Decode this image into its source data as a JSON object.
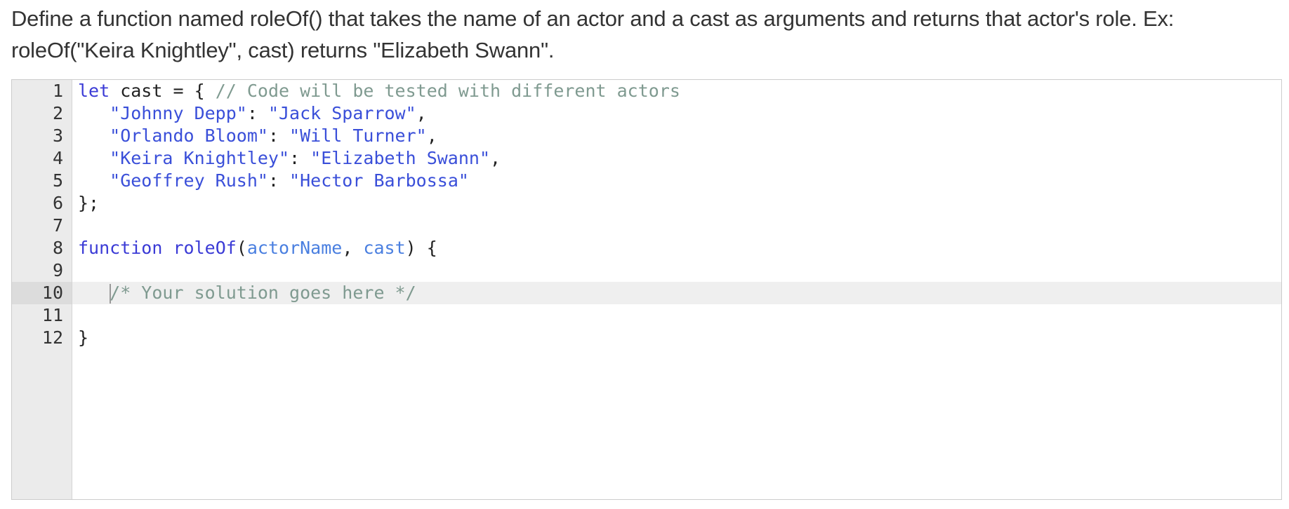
{
  "prompt": {
    "line1": "Define a function named roleOf() that takes the name of an actor and a cast as arguments and returns that actor's role. Ex:",
    "line2": "roleOf(\"Keira Knightley\", cast) returns \"Elizabeth Swann\"."
  },
  "editor": {
    "active_line": 10,
    "lines": [
      {
        "num": "1",
        "tokens": [
          {
            "t": "let",
            "c": "kw"
          },
          {
            "t": " cast ",
            "c": "pun"
          },
          {
            "t": "=",
            "c": "pun"
          },
          {
            "t": " { ",
            "c": "pun"
          },
          {
            "t": "// Code will be tested with different actors",
            "c": "cm"
          }
        ]
      },
      {
        "num": "2",
        "tokens": [
          {
            "t": "   ",
            "c": "pun"
          },
          {
            "t": "\"Johnny Depp\"",
            "c": "prop"
          },
          {
            "t": ": ",
            "c": "pun"
          },
          {
            "t": "\"Jack Sparrow\"",
            "c": "str"
          },
          {
            "t": ",",
            "c": "pun"
          }
        ]
      },
      {
        "num": "3",
        "tokens": [
          {
            "t": "   ",
            "c": "pun"
          },
          {
            "t": "\"Orlando Bloom\"",
            "c": "prop"
          },
          {
            "t": ": ",
            "c": "pun"
          },
          {
            "t": "\"Will Turner\"",
            "c": "str"
          },
          {
            "t": ",",
            "c": "pun"
          }
        ]
      },
      {
        "num": "4",
        "tokens": [
          {
            "t": "   ",
            "c": "pun"
          },
          {
            "t": "\"Keira Knightley\"",
            "c": "prop"
          },
          {
            "t": ": ",
            "c": "pun"
          },
          {
            "t": "\"Elizabeth Swann\"",
            "c": "str"
          },
          {
            "t": ",",
            "c": "pun"
          }
        ]
      },
      {
        "num": "5",
        "tokens": [
          {
            "t": "   ",
            "c": "pun"
          },
          {
            "t": "\"Geoffrey Rush\"",
            "c": "prop"
          },
          {
            "t": ": ",
            "c": "pun"
          },
          {
            "t": "\"Hector Barbossa\"",
            "c": "str"
          }
        ]
      },
      {
        "num": "6",
        "tokens": [
          {
            "t": "};",
            "c": "pun"
          }
        ]
      },
      {
        "num": "7",
        "tokens": []
      },
      {
        "num": "8",
        "tokens": [
          {
            "t": "function",
            "c": "kw"
          },
          {
            "t": " ",
            "c": "pun"
          },
          {
            "t": "roleOf",
            "c": "kw"
          },
          {
            "t": "(",
            "c": "pun"
          },
          {
            "t": "actorName",
            "c": "param"
          },
          {
            "t": ", ",
            "c": "pun"
          },
          {
            "t": "cast",
            "c": "param"
          },
          {
            "t": ") {",
            "c": "pun"
          }
        ]
      },
      {
        "num": "9",
        "tokens": []
      },
      {
        "num": "10",
        "tokens": [
          {
            "t": "   ",
            "c": "pun"
          },
          {
            "t": "CURSOR",
            "c": "cursor"
          },
          {
            "t": "/* Your solution goes here */",
            "c": "cm"
          }
        ]
      },
      {
        "num": "11",
        "tokens": []
      },
      {
        "num": "12",
        "tokens": [
          {
            "t": "}",
            "c": "pun"
          }
        ]
      }
    ]
  }
}
